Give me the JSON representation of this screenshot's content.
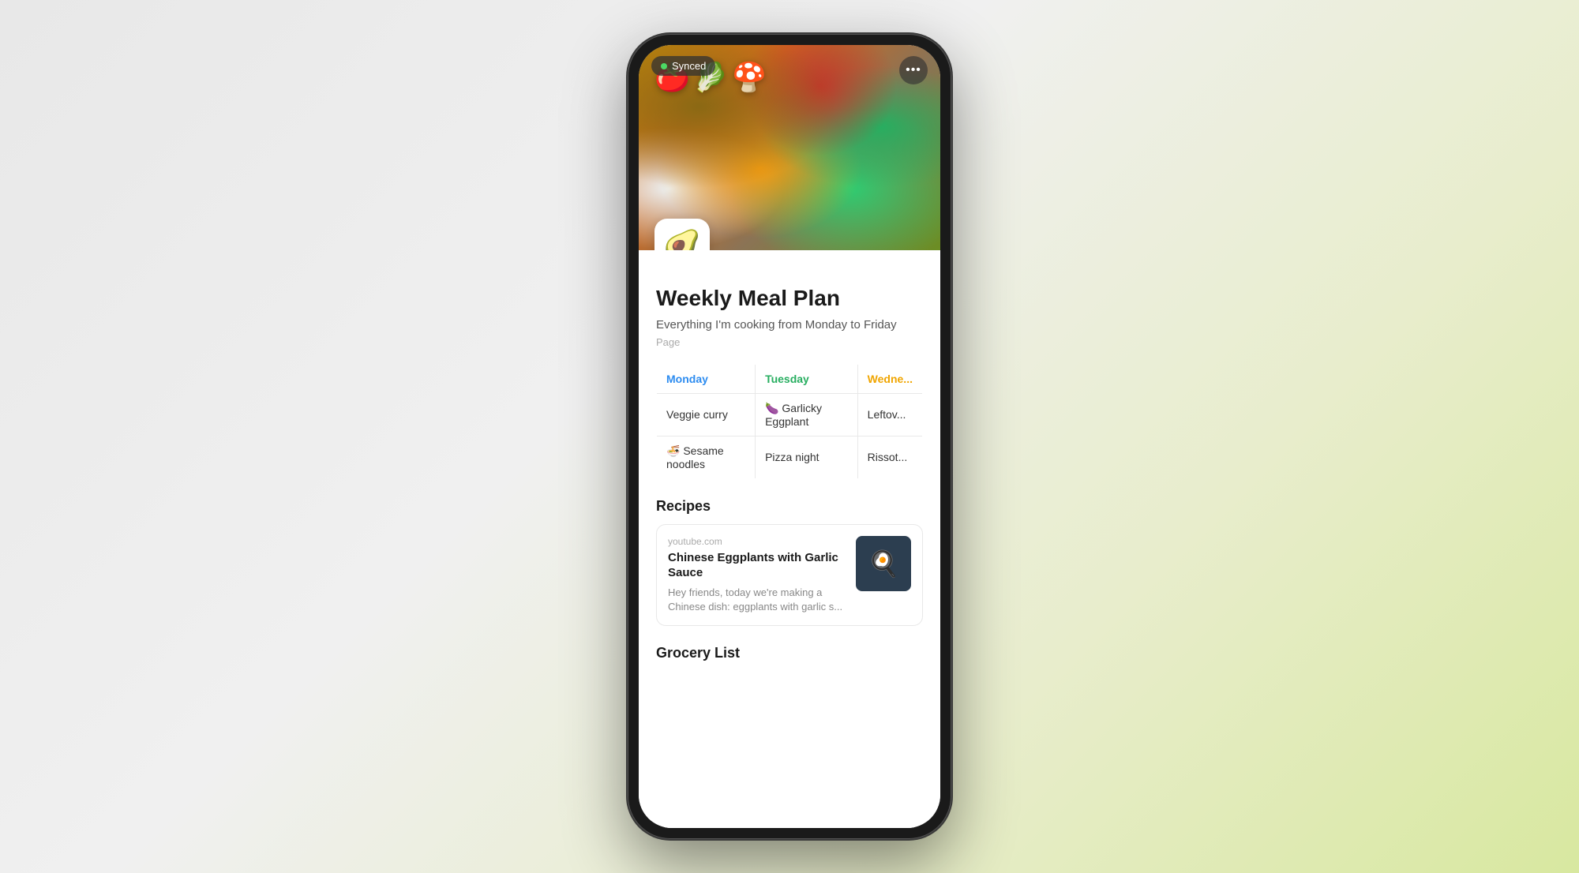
{
  "status": {
    "sync_dot_color": "#4cd964",
    "sync_label": "Synced"
  },
  "more_button": {
    "label": "•••"
  },
  "app_icon": "🥑",
  "page": {
    "title": "Weekly Meal Plan",
    "subtitle": "Everything I'm cooking from Monday to Friday",
    "type": "Page"
  },
  "meal_table": {
    "columns": [
      {
        "label": "Monday",
        "color_class": "th-monday"
      },
      {
        "label": "Tuesday",
        "color_class": "th-tuesday"
      },
      {
        "label": "Wedne...",
        "color_class": "th-wednesday"
      }
    ],
    "rows": [
      {
        "monday": "Veggie curry",
        "tuesday": "🍆 Garlicky Eggplant",
        "wednesday": "Leftov..."
      },
      {
        "monday": "🍜 Sesame noodles",
        "tuesday": "Pizza night",
        "wednesday": "Rissot..."
      }
    ]
  },
  "sections": {
    "recipes_heading": "Recipes",
    "grocery_heading": "Grocery List"
  },
  "recipe_card": {
    "source": "youtube.com",
    "title": "Chinese Eggplants with Garlic Sauce",
    "description": "Hey friends, today we're making a Chinese dish: eggplants with garlic s...",
    "thumbnail_emoji": "🍳"
  }
}
